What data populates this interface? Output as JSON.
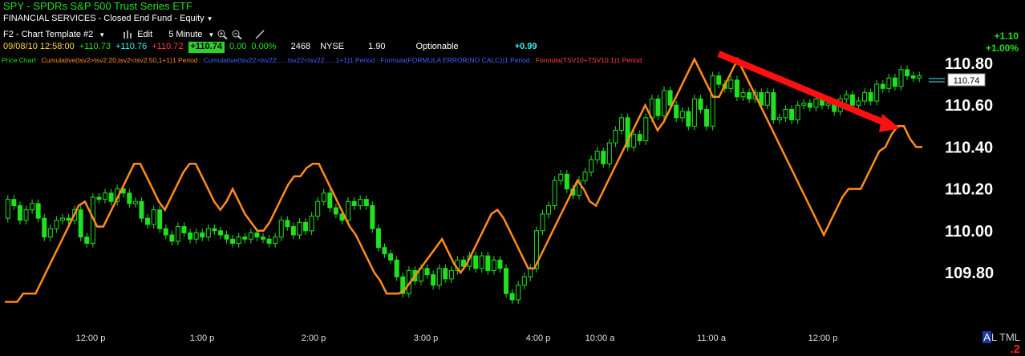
{
  "header": {
    "symbol_line": "SPY - SPDRs S&P 500 Trust Series ETF",
    "sector_line": "FINANCIAL SERVICES - Closed End Fund - Equity",
    "template": "F2 - Chart Template #2",
    "edit": "Edit",
    "interval": "5 Minute",
    "datetime": "09/08/10 12:58:00",
    "open": "+110.73",
    "high": "+110.76",
    "low": "+110.72",
    "close": "+110.74",
    "change": "0.00",
    "change_pct": "0.00%",
    "volume": "2468",
    "exchange": "NYSE",
    "value_190": "1.90",
    "optionable": "Optionable",
    "net": "+0.99",
    "top_right_change": "+1.10",
    "top_right_pct": "+1.00%"
  },
  "studies": {
    "price": "Price Chart",
    "s1": "Cumulative(tsv2>tsv2.20,tsv2<tsv2.50,1+1)1 Period",
    "s2": "Cumulative(tsv22>tsv22......tsv22<tsv22......1+1)1 Period",
    "s3": "Formula(FORMULA ERROR(NO CALC))1 Period",
    "s4": "Formula(TSV10+TSV10.1)1 Period"
  },
  "corner": {
    "tabs": "AL TML",
    "tab_active": "A",
    "num": ".2"
  },
  "colors": {
    "candle": "#21e021",
    "indicator": "#ff8c1a",
    "arrow": "#ff1010",
    "last_box": "#ffffff"
  },
  "chart_data": {
    "type": "candlestick",
    "ylim": [
      109.64,
      110.88
    ],
    "y_ticks": [
      "110.80",
      "110.60",
      "110.40",
      "110.20",
      "110.00",
      "109.80"
    ],
    "x_ticks": [
      "12:00 p",
      "1:00 p",
      "2:00 p",
      "3:00 p",
      "4:00 p",
      "10:00 a",
      "11:00 a",
      "12:00 p"
    ],
    "last_price_label": "110.74",
    "candles": [
      {
        "o": 110.06,
        "c": 110.15
      },
      {
        "o": 110.15,
        "c": 110.12
      },
      {
        "o": 110.12,
        "c": 110.05
      },
      {
        "o": 110.05,
        "c": 110.1
      },
      {
        "o": 110.1,
        "c": 110.13
      },
      {
        "o": 110.13,
        "c": 110.06
      },
      {
        "o": 110.06,
        "c": 109.97
      },
      {
        "o": 109.97,
        "c": 110.01
      },
      {
        "o": 110.01,
        "c": 110.05
      },
      {
        "o": 110.05,
        "c": 110.06
      },
      {
        "o": 110.06,
        "c": 110.05
      },
      {
        "o": 110.05,
        "c": 110.1
      },
      {
        "o": 110.1,
        "c": 109.97
      },
      {
        "o": 109.97,
        "c": 109.94
      },
      {
        "o": 109.94,
        "c": 110.16
      },
      {
        "o": 110.16,
        "c": 110.15
      },
      {
        "o": 110.15,
        "c": 110.18
      },
      {
        "o": 110.18,
        "c": 110.14
      },
      {
        "o": 110.14,
        "c": 110.2
      },
      {
        "o": 110.2,
        "c": 110.18
      },
      {
        "o": 110.18,
        "c": 110.13
      },
      {
        "o": 110.13,
        "c": 110.14
      },
      {
        "o": 110.14,
        "c": 110.06
      },
      {
        "o": 110.06,
        "c": 110.03
      },
      {
        "o": 110.03,
        "c": 110.1
      },
      {
        "o": 110.1,
        "c": 110.01
      },
      {
        "o": 110.01,
        "c": 109.98
      },
      {
        "o": 109.98,
        "c": 109.95
      },
      {
        "o": 109.95,
        "c": 110.02
      },
      {
        "o": 110.02,
        "c": 109.99
      },
      {
        "o": 109.99,
        "c": 109.96
      },
      {
        "o": 109.96,
        "c": 109.99
      },
      {
        "o": 109.99,
        "c": 109.97
      },
      {
        "o": 109.97,
        "c": 110.01
      },
      {
        "o": 110.01,
        "c": 110.0
      },
      {
        "o": 110.0,
        "c": 109.98
      },
      {
        "o": 109.98,
        "c": 109.96
      },
      {
        "o": 109.96,
        "c": 109.94
      },
      {
        "o": 109.94,
        "c": 109.97
      },
      {
        "o": 109.97,
        "c": 109.96
      },
      {
        "o": 109.96,
        "c": 109.99
      },
      {
        "o": 109.99,
        "c": 109.97
      },
      {
        "o": 109.97,
        "c": 109.96
      },
      {
        "o": 109.96,
        "c": 109.94
      },
      {
        "o": 109.94,
        "c": 109.97
      },
      {
        "o": 109.97,
        "c": 110.05
      },
      {
        "o": 110.05,
        "c": 110.02
      },
      {
        "o": 110.02,
        "c": 109.98
      },
      {
        "o": 109.98,
        "c": 110.04
      },
      {
        "o": 110.04,
        "c": 110.0
      },
      {
        "o": 110.0,
        "c": 110.07
      },
      {
        "o": 110.07,
        "c": 110.14
      },
      {
        "o": 110.14,
        "c": 110.18
      },
      {
        "o": 110.18,
        "c": 110.11
      },
      {
        "o": 110.11,
        "c": 110.08
      },
      {
        "o": 110.08,
        "c": 110.05
      },
      {
        "o": 110.05,
        "c": 110.14
      },
      {
        "o": 110.14,
        "c": 110.12
      },
      {
        "o": 110.12,
        "c": 110.15
      },
      {
        "o": 110.15,
        "c": 110.12
      },
      {
        "o": 110.12,
        "c": 110.01
      },
      {
        "o": 110.01,
        "c": 109.92
      },
      {
        "o": 109.92,
        "c": 109.89
      },
      {
        "o": 109.89,
        "c": 109.86
      },
      {
        "o": 109.86,
        "c": 109.78
      },
      {
        "o": 109.78,
        "c": 109.7
      },
      {
        "o": 109.7,
        "c": 109.81
      },
      {
        "o": 109.81,
        "c": 109.76
      },
      {
        "o": 109.76,
        "c": 109.82
      },
      {
        "o": 109.82,
        "c": 109.79
      },
      {
        "o": 109.79,
        "c": 109.74
      },
      {
        "o": 109.74,
        "c": 109.82
      },
      {
        "o": 109.82,
        "c": 109.77
      },
      {
        "o": 109.77,
        "c": 109.81
      },
      {
        "o": 109.81,
        "c": 109.86
      },
      {
        "o": 109.86,
        "c": 109.83
      },
      {
        "o": 109.83,
        "c": 109.88
      },
      {
        "o": 109.88,
        "c": 109.82
      },
      {
        "o": 109.82,
        "c": 109.88
      },
      {
        "o": 109.88,
        "c": 109.81
      },
      {
        "o": 109.81,
        "c": 109.86
      },
      {
        "o": 109.86,
        "c": 109.82
      },
      {
        "o": 109.82,
        "c": 109.7
      },
      {
        "o": 109.7,
        "c": 109.67
      },
      {
        "o": 109.67,
        "c": 109.74
      },
      {
        "o": 109.74,
        "c": 109.78
      },
      {
        "o": 109.78,
        "c": 109.82
      },
      {
        "o": 109.82,
        "c": 110.0
      },
      {
        "o": 110.0,
        "c": 110.08
      },
      {
        "o": 110.08,
        "c": 110.12
      },
      {
        "o": 110.12,
        "c": 110.24
      },
      {
        "o": 110.24,
        "c": 110.27
      },
      {
        "o": 110.27,
        "c": 110.2
      },
      {
        "o": 110.2,
        "c": 110.17
      },
      {
        "o": 110.17,
        "c": 110.24
      },
      {
        "o": 110.24,
        "c": 110.28
      },
      {
        "o": 110.28,
        "c": 110.34
      },
      {
        "o": 110.34,
        "c": 110.38
      },
      {
        "o": 110.38,
        "c": 110.32
      },
      {
        "o": 110.32,
        "c": 110.42
      },
      {
        "o": 110.42,
        "c": 110.48
      },
      {
        "o": 110.48,
        "c": 110.54
      },
      {
        "o": 110.54,
        "c": 110.4
      },
      {
        "o": 110.4,
        "c": 110.46
      },
      {
        "o": 110.46,
        "c": 110.43
      },
      {
        "o": 110.43,
        "c": 110.54
      },
      {
        "o": 110.54,
        "c": 110.63
      },
      {
        "o": 110.63,
        "c": 110.55
      },
      {
        "o": 110.55,
        "c": 110.67
      },
      {
        "o": 110.67,
        "c": 110.6
      },
      {
        "o": 110.6,
        "c": 110.54
      },
      {
        "o": 110.54,
        "c": 110.57
      },
      {
        "o": 110.57,
        "c": 110.5
      },
      {
        "o": 110.5,
        "c": 110.63
      },
      {
        "o": 110.63,
        "c": 110.58
      },
      {
        "o": 110.58,
        "c": 110.5
      },
      {
        "o": 110.5,
        "c": 110.74
      },
      {
        "o": 110.74,
        "c": 110.7
      },
      {
        "o": 110.7,
        "c": 110.68
      },
      {
        "o": 110.68,
        "c": 110.72
      },
      {
        "o": 110.72,
        "c": 110.64
      },
      {
        "o": 110.64,
        "c": 110.66
      },
      {
        "o": 110.66,
        "c": 110.63
      },
      {
        "o": 110.63,
        "c": 110.66
      },
      {
        "o": 110.66,
        "c": 110.6
      },
      {
        "o": 110.6,
        "c": 110.66
      },
      {
        "o": 110.66,
        "c": 110.53
      },
      {
        "o": 110.53,
        "c": 110.54
      },
      {
        "o": 110.54,
        "c": 110.58
      },
      {
        "o": 110.58,
        "c": 110.53
      },
      {
        "o": 110.53,
        "c": 110.6
      },
      {
        "o": 110.6,
        "c": 110.61
      },
      {
        "o": 110.61,
        "c": 110.59
      },
      {
        "o": 110.59,
        "c": 110.63
      },
      {
        "o": 110.63,
        "c": 110.6
      },
      {
        "o": 110.6,
        "c": 110.61
      },
      {
        "o": 110.61,
        "c": 110.57
      },
      {
        "o": 110.57,
        "c": 110.63
      },
      {
        "o": 110.63,
        "c": 110.65
      },
      {
        "o": 110.65,
        "c": 110.6
      },
      {
        "o": 110.6,
        "c": 110.62
      },
      {
        "o": 110.62,
        "c": 110.66
      },
      {
        "o": 110.66,
        "c": 110.62
      },
      {
        "o": 110.62,
        "c": 110.7
      },
      {
        "o": 110.7,
        "c": 110.68
      },
      {
        "o": 110.68,
        "c": 110.73
      },
      {
        "o": 110.73,
        "c": 110.69
      },
      {
        "o": 110.69,
        "c": 110.77
      },
      {
        "o": 110.77,
        "c": 110.74
      },
      {
        "o": 110.74,
        "c": 110.73
      },
      {
        "o": 110.73,
        "c": 110.74
      }
    ],
    "indicator": {
      "name": "Cumulative",
      "values": [
        109.66,
        109.66,
        109.66,
        109.7,
        109.7,
        109.7,
        109.76,
        109.82,
        109.88,
        109.94,
        110.0,
        110.06,
        110.12,
        110.14,
        110.08,
        110.02,
        110.02,
        110.08,
        110.14,
        110.2,
        110.26,
        110.32,
        110.32,
        110.26,
        110.2,
        110.14,
        110.1,
        110.16,
        110.22,
        110.28,
        110.32,
        110.32,
        110.26,
        110.2,
        110.14,
        110.1,
        110.14,
        110.2,
        110.14,
        110.08,
        110.04,
        110.0,
        110.0,
        110.04,
        110.1,
        110.16,
        110.22,
        110.26,
        110.26,
        110.3,
        110.32,
        110.32,
        110.26,
        110.2,
        110.14,
        110.08,
        110.02,
        109.98,
        109.92,
        109.86,
        109.8,
        109.76,
        109.7,
        109.7,
        109.7,
        109.72,
        109.76,
        109.8,
        109.84,
        109.88,
        109.92,
        109.96,
        109.9,
        109.84,
        109.8,
        109.84,
        109.9,
        109.96,
        110.02,
        110.08,
        110.1,
        110.06,
        110.0,
        109.94,
        109.88,
        109.82,
        109.82,
        109.88,
        109.94,
        110.0,
        110.06,
        110.12,
        110.18,
        110.24,
        110.2,
        110.14,
        110.12,
        110.18,
        110.24,
        110.3,
        110.36,
        110.42,
        110.48,
        110.54,
        110.6,
        110.54,
        110.48,
        110.52,
        110.58,
        110.64,
        110.7,
        110.76,
        110.82,
        110.76,
        110.7,
        110.64,
        110.64,
        110.7,
        110.76,
        110.82,
        110.76,
        110.7,
        110.64,
        110.58,
        110.52,
        110.46,
        110.4,
        110.34,
        110.28,
        110.22,
        110.16,
        110.1,
        110.04,
        109.98,
        110.04,
        110.1,
        110.16,
        110.2,
        110.2,
        110.2,
        110.26,
        110.32,
        110.38,
        110.4,
        110.46,
        110.5,
        110.5,
        110.44,
        110.4,
        110.4
      ]
    }
  }
}
